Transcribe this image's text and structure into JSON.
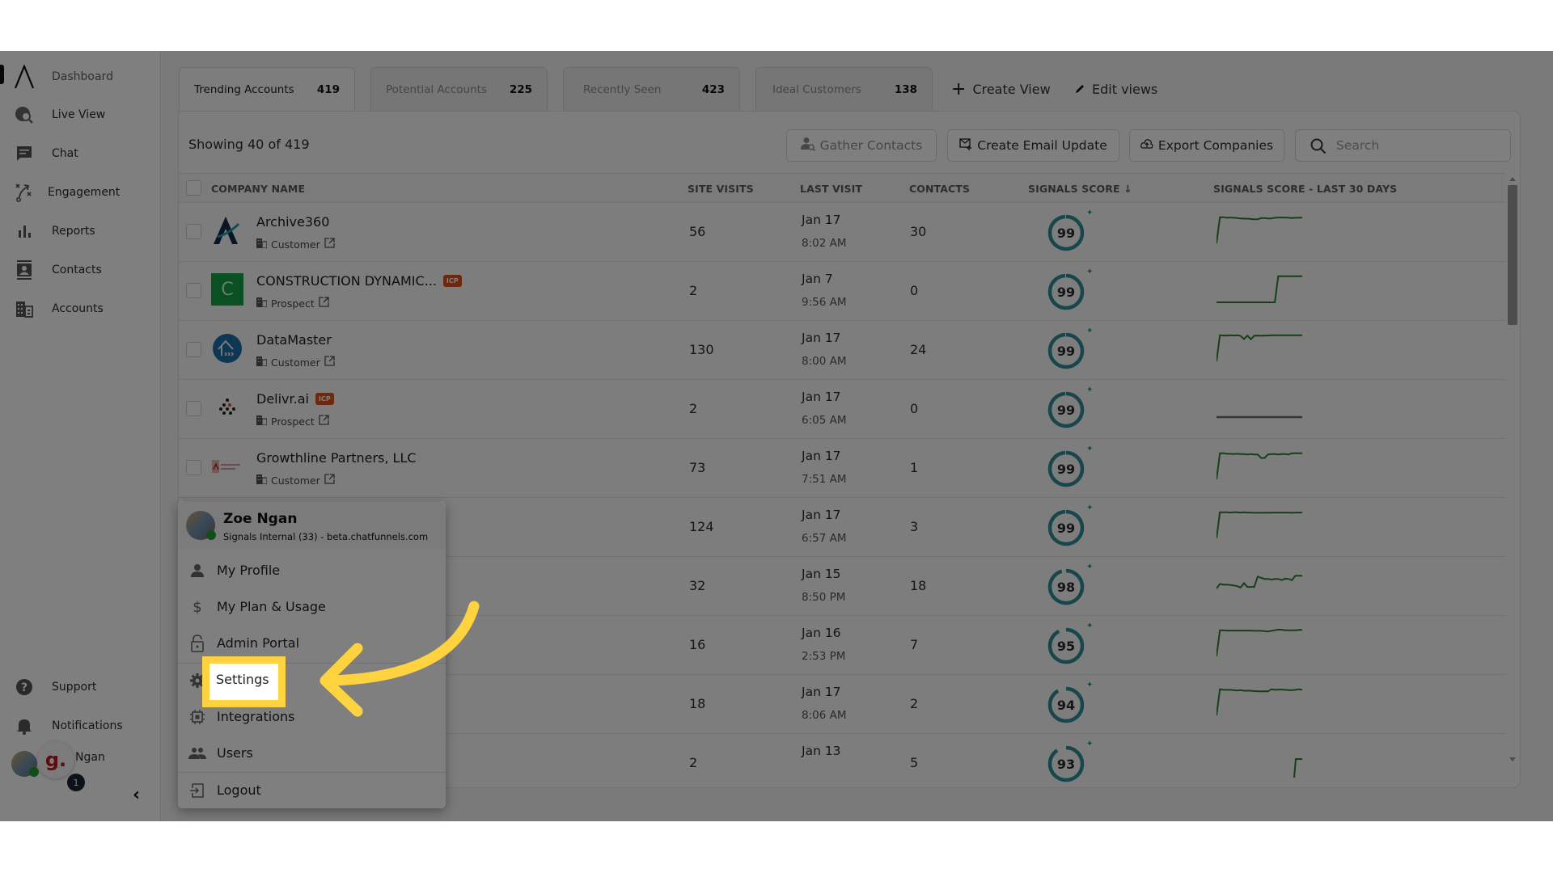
{
  "sidebar": {
    "items": [
      {
        "label": "Dashboard",
        "icon": "logo-caret-icon"
      },
      {
        "label": "Live View",
        "icon": "globe-search-icon"
      },
      {
        "label": "Chat",
        "icon": "chat-icon"
      },
      {
        "label": "Engagement",
        "icon": "strategy-icon"
      },
      {
        "label": "Reports",
        "icon": "bar-chart-icon"
      },
      {
        "label": "Contacts",
        "icon": "contact-card-icon"
      },
      {
        "label": "Accounts",
        "icon": "building-icon"
      }
    ],
    "bottom": [
      {
        "label": "Support",
        "icon": "help-icon"
      },
      {
        "label": "Notifications",
        "icon": "bell-icon"
      }
    ],
    "user_label": "Ngan",
    "badge_letter": "g.",
    "notification_count": "1",
    "collapse_glyph": "‹"
  },
  "tabs": [
    {
      "label": "Trending Accounts",
      "count": "419",
      "active": true
    },
    {
      "label": "Potential Accounts",
      "count": "225",
      "active": false
    },
    {
      "label": "Recently Seen",
      "count": "423",
      "active": false
    },
    {
      "label": "Ideal Customers",
      "count": "138",
      "active": false
    }
  ],
  "actions": {
    "create_view": "Create View",
    "edit_views": "Edit views"
  },
  "toolbar": {
    "showing": "Showing 40 of  419",
    "gather_contacts": "Gather Contacts",
    "create_email_update": "Create Email Update",
    "export_companies": "Export Companies",
    "search_placeholder": "Search"
  },
  "table": {
    "columns": [
      "COMPANY NAME",
      "SITE VISITS",
      "LAST VISIT",
      "CONTACTS",
      "SIGNALS SCORE ↓",
      "SIGNALS SCORE - LAST 30 DAYS"
    ],
    "rows": [
      {
        "name": "Archive360",
        "icp": false,
        "type": "Customer",
        "logo": "archive360",
        "visits": "56",
        "date": "Jan 17",
        "time": "8:02 AM",
        "contacts": "30",
        "score": 99,
        "trend": [
          0,
          88,
          88,
          86,
          87,
          86,
          85,
          84,
          83,
          83,
          82,
          81,
          81,
          85,
          85,
          84,
          84,
          86,
          87,
          87,
          87,
          86,
          85,
          86,
          86,
          87
        ]
      },
      {
        "name": "CONSTRUCTION DYNAMIC...",
        "icp": true,
        "type": "Prospect",
        "logo": "construction",
        "visits": "2",
        "date": "Jan 7",
        "time": "9:56 AM",
        "contacts": "0",
        "score": 99,
        "trend": [
          0,
          0,
          0,
          0,
          0,
          0,
          0,
          0,
          0,
          0,
          0,
          0,
          0,
          0,
          0,
          0,
          0,
          0,
          88,
          88,
          88,
          88,
          88,
          88,
          88,
          88
        ]
      },
      {
        "name": "DataMaster",
        "icp": false,
        "type": "Customer",
        "logo": "datamaster",
        "visits": "130",
        "date": "Jan 17",
        "time": "8:00 AM",
        "contacts": "24",
        "score": 99,
        "trend": [
          0,
          88,
          87,
          87,
          88,
          87,
          88,
          86,
          75,
          87,
          74,
          86,
          87,
          86,
          87,
          87,
          88,
          88,
          88,
          88,
          88,
          88,
          88,
          88,
          88,
          88
        ]
      },
      {
        "name": "Delivr.ai",
        "icp": true,
        "type": "Prospect",
        "logo": "delivr",
        "visits": "2",
        "date": "Jan 17",
        "time": "6:05 AM",
        "contacts": "0",
        "score": 99,
        "trend": "flat"
      },
      {
        "name": "Growthline Partners, LLC",
        "icp": false,
        "type": "Customer",
        "logo": "growthline",
        "visits": "73",
        "date": "Jan 17",
        "time": "7:51 AM",
        "contacts": "1",
        "score": 99,
        "trend": [
          0,
          88,
          88,
          86,
          86,
          85,
          86,
          85,
          85,
          84,
          85,
          84,
          84,
          72,
          72,
          84,
          85,
          85,
          84,
          85,
          85,
          84,
          88,
          88,
          88,
          88
        ]
      },
      {
        "name": "",
        "icp": false,
        "type": "",
        "logo": "",
        "visits": "124",
        "date": "Jan 17",
        "time": "6:57 AM",
        "contacts": "3",
        "score": 99,
        "trend": [
          0,
          88,
          88,
          88,
          87,
          88,
          88,
          87,
          88,
          87,
          87,
          86,
          86,
          86,
          87,
          86,
          87,
          87,
          87,
          87,
          87,
          87,
          86,
          87,
          87,
          87
        ]
      },
      {
        "name": "",
        "icp": false,
        "type": "",
        "logo": "",
        "visits": "32",
        "date": "Jan 15",
        "time": "8:50 PM",
        "contacts": "18",
        "score": 98,
        "trend": [
          30,
          45,
          43,
          43,
          42,
          40,
          38,
          33,
          48,
          35,
          35,
          35,
          70,
          66,
          62,
          62,
          60,
          62,
          62,
          58,
          63,
          62,
          58,
          73,
          73,
          73
        ]
      },
      {
        "name": "",
        "icp": false,
        "type": "",
        "logo": "",
        "visits": "16",
        "date": "Jan 16",
        "time": "2:53 PM",
        "contacts": "7",
        "score": 95,
        "trend": [
          0,
          88,
          88,
          87,
          87,
          87,
          87,
          87,
          87,
          87,
          87,
          86,
          86,
          86,
          85,
          84,
          86,
          88,
          90,
          90,
          88,
          88,
          88,
          88,
          89,
          89
        ]
      },
      {
        "name": "",
        "icp": false,
        "type": "",
        "logo": "",
        "visits": "18",
        "date": "Jan 17",
        "time": "8:06 AM",
        "contacts": "2",
        "score": 94,
        "trend": [
          0,
          88,
          86,
          86,
          86,
          85,
          84,
          85,
          83,
          83,
          83,
          82,
          81,
          81,
          81,
          81,
          88,
          86,
          87,
          87,
          86,
          85,
          85,
          86,
          88,
          86
        ]
      },
      {
        "name": "",
        "icp": false,
        "type": "",
        "logo": "",
        "visits": "2",
        "date": "Jan 13",
        "time": "",
        "contacts": "5",
        "score": 93,
        "trend": "late"
      }
    ]
  },
  "user_menu": {
    "name": "Zoe Ngan",
    "org": "Signals Internal (33) - beta.chatfunnels.com",
    "items": [
      {
        "label": "My Profile",
        "icon": "person-icon"
      },
      {
        "label": "My Plan & Usage",
        "icon": "dollar-icon"
      },
      {
        "label": "Admin Portal",
        "icon": "lock-icon"
      },
      {
        "label": "Settings",
        "icon": "gear-icon"
      },
      {
        "label": "Integrations",
        "icon": "chip-icon"
      },
      {
        "label": "Users",
        "icon": "people-icon"
      },
      {
        "label": "Logout",
        "icon": "logout-icon"
      }
    ]
  },
  "annotation": {
    "highlight_label": "Settings",
    "color": "#ffd23f"
  },
  "colors": {
    "score_ring": "#2e8f96",
    "sparkline": "#2e7d32",
    "icp_badge": "#d9531e",
    "online_dot": "#1f9d32"
  }
}
